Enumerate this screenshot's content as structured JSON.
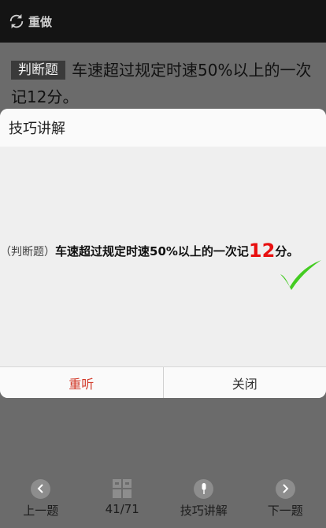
{
  "topbar": {
    "redo_label": "重做"
  },
  "question": {
    "tag": "判断题",
    "text": "车速超过规定时速50%以上的一次记12分。"
  },
  "dialog": {
    "title": "技巧讲解",
    "explain_prefix": "（判断题）",
    "explain_main": "车速超过规定时速50%以上的一次记",
    "explain_highlight": "12",
    "explain_suffix": "分。",
    "replay_label": "重听",
    "close_label": "关闭",
    "colors": {
      "highlight": "#e81010",
      "check": "#44cc22",
      "replay": "#d23a2a"
    }
  },
  "bottombar": {
    "prev_label": "上一题",
    "progress_label": "41/71",
    "tips_label": "技巧讲解",
    "next_label": "下一题"
  }
}
